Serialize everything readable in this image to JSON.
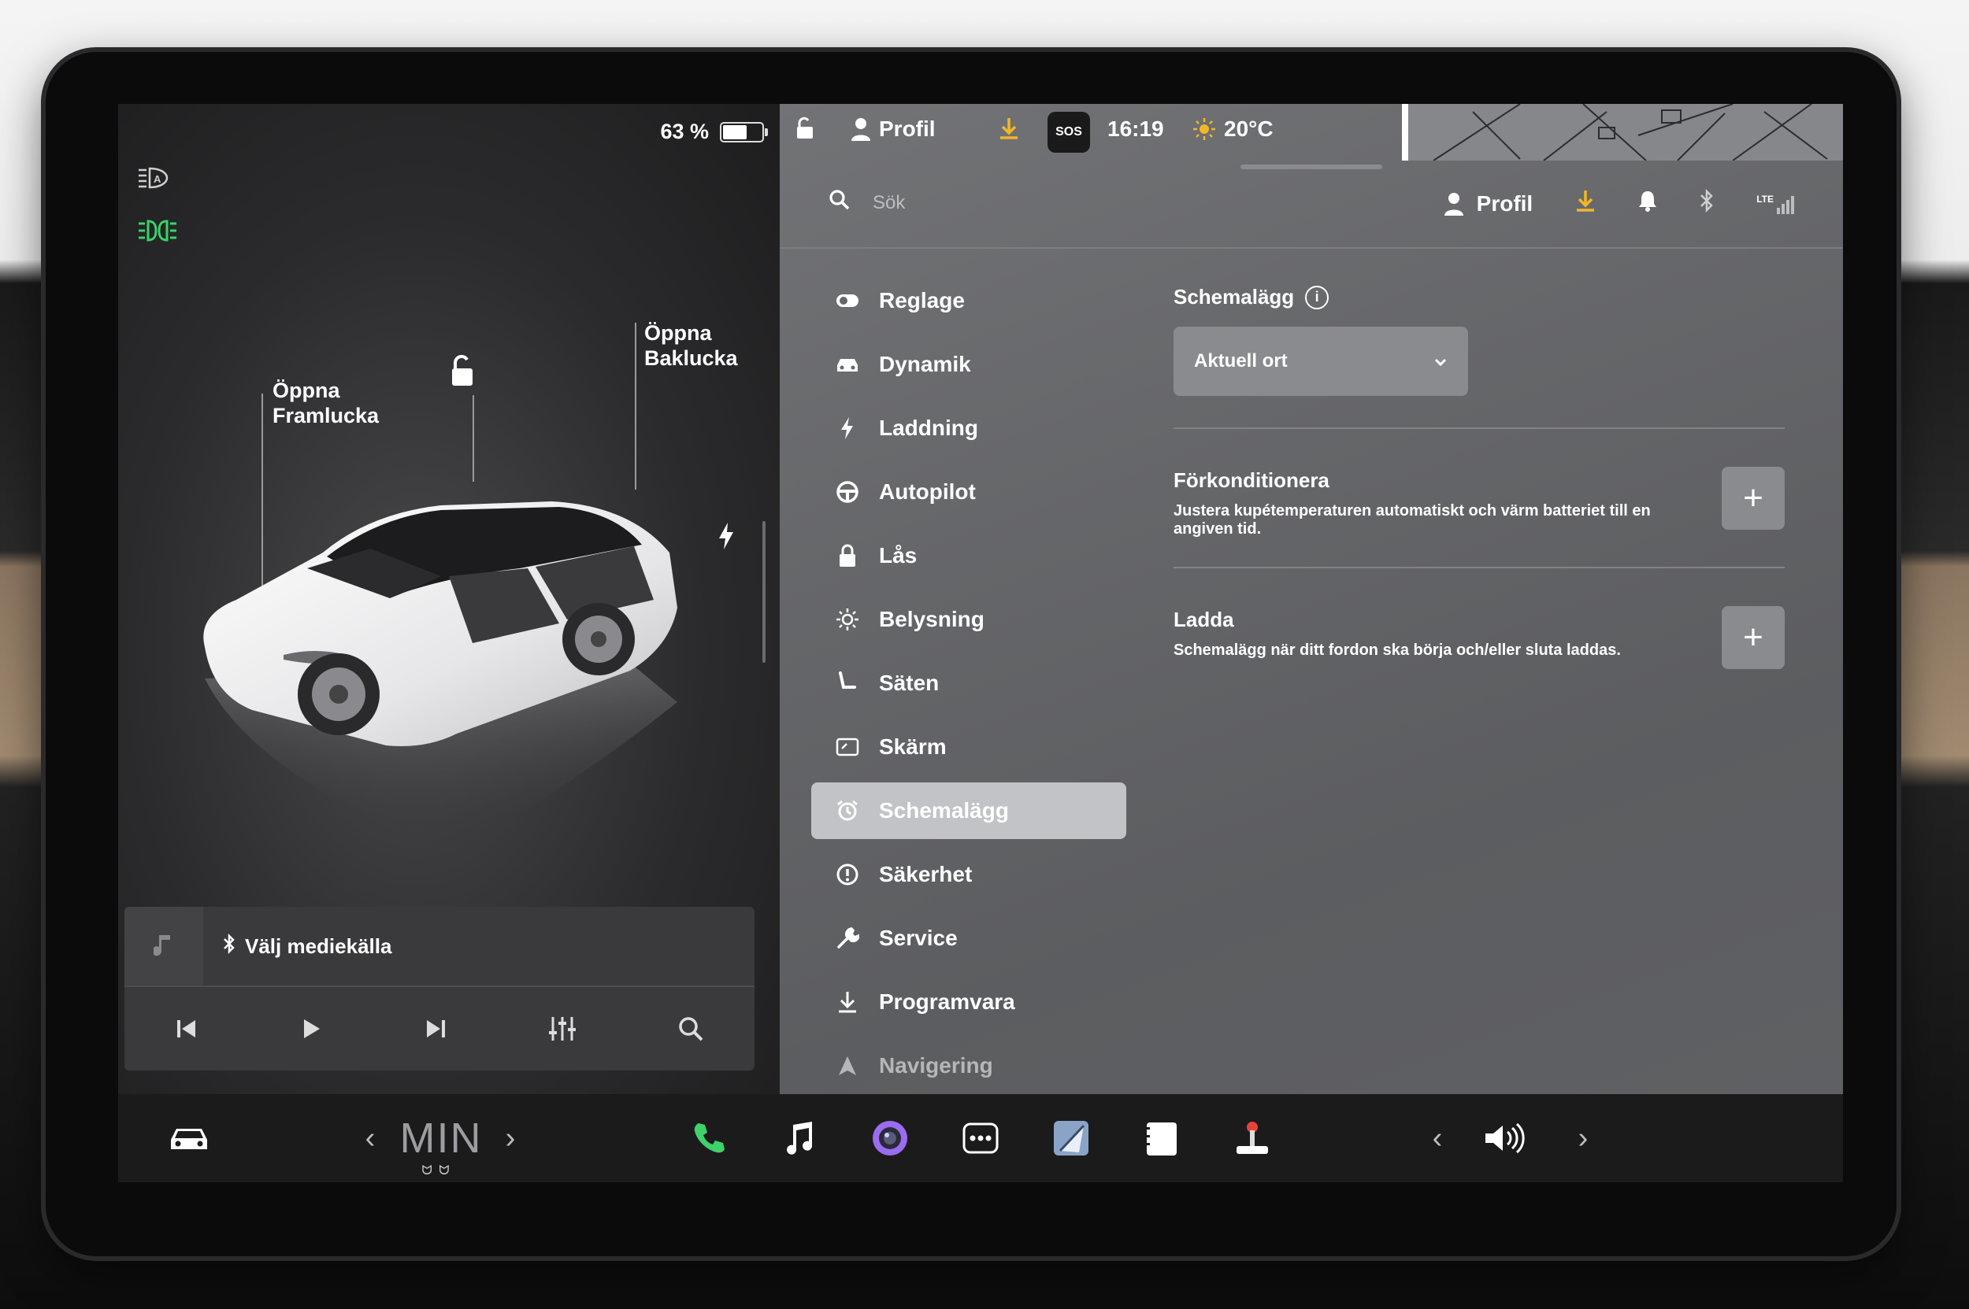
{
  "left": {
    "battery": {
      "percent_label": "63 %",
      "level": 0.63
    },
    "labels": {
      "front_trunk_line1": "Öppna",
      "front_trunk_line2": "Framlucka",
      "rear_trunk_line1": "Öppna",
      "rear_trunk_line2": "Baklucka"
    },
    "icons": [
      "auto-headlights-icon",
      "drl-icon",
      "unlock-icon",
      "charge-bolt-icon"
    ],
    "media": {
      "source_label": "Välj mediekälla",
      "controls": [
        "previous-track-icon",
        "play-icon",
        "next-track-icon",
        "equalizer-icon",
        "search-icon"
      ]
    }
  },
  "statusbar": {
    "profile_label": "Profil",
    "sos_label": "SOS",
    "time": "16:19",
    "temperature": "20°C"
  },
  "topbar": {
    "search_placeholder": "Sök",
    "profile_label": "Profil",
    "icons": [
      "download-icon",
      "bell-icon",
      "bluetooth-icon",
      "lte-signal-icon"
    ],
    "lte_label": "LTE"
  },
  "menu": {
    "items": [
      {
        "label": "Reglage",
        "icon": "toggle-icon"
      },
      {
        "label": "Dynamik",
        "icon": "car-icon"
      },
      {
        "label": "Laddning",
        "icon": "bolt-icon"
      },
      {
        "label": "Autopilot",
        "icon": "steering-wheel-icon"
      },
      {
        "label": "Lås",
        "icon": "lock-icon"
      },
      {
        "label": "Belysning",
        "icon": "sun-icon"
      },
      {
        "label": "Säten",
        "icon": "seat-icon"
      },
      {
        "label": "Skärm",
        "icon": "display-icon"
      },
      {
        "label": "Schemalägg",
        "icon": "alarm-clock-icon",
        "active": true
      },
      {
        "label": "Säkerhet",
        "icon": "alert-circle-icon"
      },
      {
        "label": "Service",
        "icon": "wrench-icon"
      },
      {
        "label": "Programvara",
        "icon": "download-icon"
      },
      {
        "label": "Navigering",
        "icon": "navigation-icon"
      }
    ]
  },
  "content": {
    "title": "Schemalägg",
    "dropdown_value": "Aktuell ort",
    "sections": [
      {
        "title": "Förkonditionera",
        "description": "Justera kupétemperaturen automatiskt och värm batteriet till en angiven tid."
      },
      {
        "title": "Ladda",
        "description": "Schemalägg när ditt fordon ska börja och/eller sluta laddas."
      }
    ]
  },
  "bottom": {
    "climate_temp": "MIN",
    "apps": [
      "phone-icon",
      "music-icon",
      "camera-icon",
      "more-icon",
      "toybox-icon",
      "calendar-icon",
      "joystick-icon"
    ],
    "volume_icon": "volume-icon",
    "accent_phone": "#3fd16a"
  }
}
